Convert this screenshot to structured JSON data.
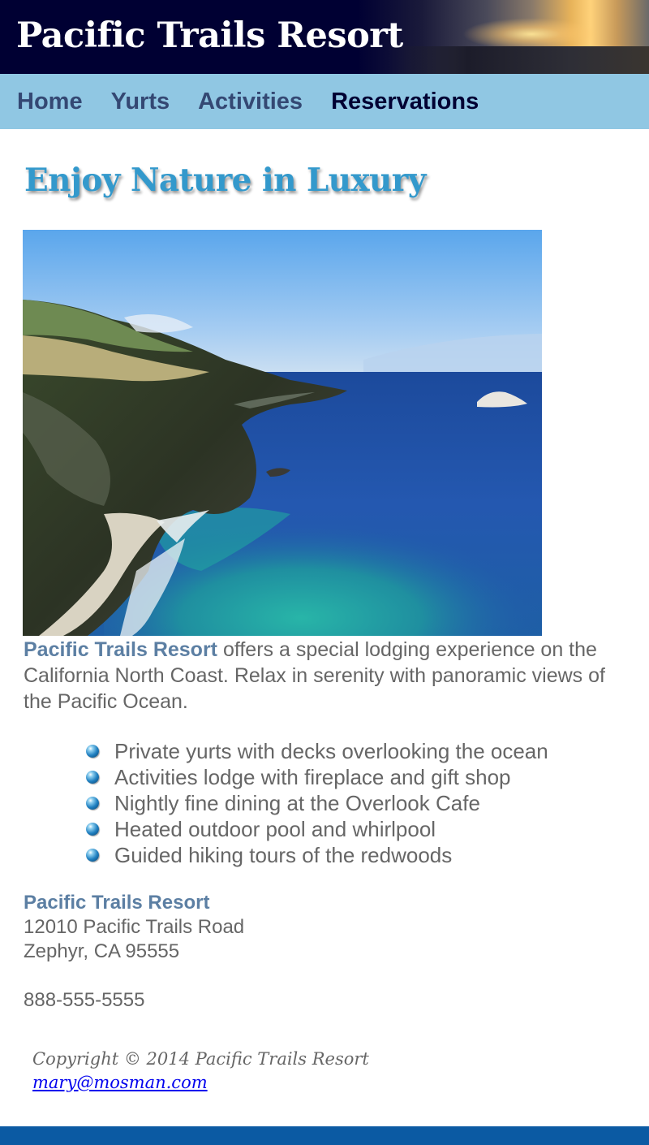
{
  "header": {
    "title": "Pacific Trails Resort"
  },
  "nav": {
    "items": [
      {
        "label": "Home"
      },
      {
        "label": "Yurts"
      },
      {
        "label": "Activities"
      },
      {
        "label": "Reservations"
      }
    ]
  },
  "main": {
    "heading": "Enjoy Nature in Luxury",
    "intro_brand": "Pacific Trails Resort",
    "intro_text": " offers a special lodging experience on the California North Coast. Relax in serenity with panoramic views of the Pacific Ocean.",
    "features": [
      "Private yurts with decks overlooking the ocean",
      "Activities lodge with fireplace and gift shop",
      "Nightly fine dining at the Overlook Cafe",
      "Heated outdoor pool and whirlpool",
      "Guided hiking tours of the redwoods"
    ]
  },
  "contact": {
    "name": "Pacific Trails Resort",
    "street": "12010 Pacific Trails Road",
    "city": "Zephyr, CA 95555",
    "phone": "888-555-5555"
  },
  "footer": {
    "copyright": "Copyright © 2014 Pacific Trails Resort",
    "email": "mary@mosman.com"
  },
  "colors": {
    "nav_background": "#90c7e3",
    "heading": "#3399cc",
    "brand_text": "#5c7fa3",
    "header_background": "#000033",
    "bottom_bar": "#0b5aa3"
  },
  "icons": {
    "feature_bullet": "blue-sphere-bullet-icon"
  }
}
